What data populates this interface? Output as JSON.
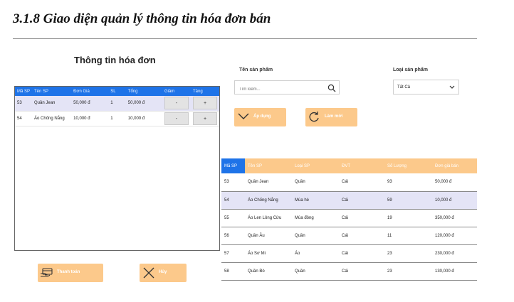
{
  "doc_heading": "3.1.8 Giao diện quản lý thông tin hóa đơn bán",
  "cart": {
    "title": "Thông tin hóa đơn",
    "columns": [
      "Mã SP",
      "Tên SP",
      "Đơn Giá",
      "SL",
      "Tổng",
      "Giảm",
      "Tăng"
    ],
    "rows": [
      {
        "ma": "53",
        "ten": "Quần Jean",
        "gia": "50,000 đ",
        "sl": "1",
        "tong": "50,000 đ",
        "giam": "-",
        "tang": "+"
      },
      {
        "ma": "54",
        "ten": "Áo Chống Nắng",
        "gia": "10,000 đ",
        "sl": "1",
        "tong": "10,000 đ",
        "giam": "-",
        "tang": "+"
      }
    ]
  },
  "filters": {
    "product_name_label": "Tên sản phẩm",
    "search_placeholder": "Tìm kiếm...",
    "category_label": "Loại sản phẩm",
    "category_value": "Tất Cả"
  },
  "buttons": {
    "apply": "Áp dụng",
    "refresh": "Làm mới",
    "pay": "Thanh toán",
    "cancel": "Hủy"
  },
  "products": {
    "columns": [
      "Mã SP",
      "Tên SP",
      "Loại SP",
      "ĐVT",
      "Số Lượng",
      "Đơn giá bán"
    ],
    "rows": [
      {
        "ma": "53",
        "ten": "Quần Jean",
        "loai": "Quần",
        "dvt": "Cái",
        "sl": "93",
        "gia": "50,000 đ"
      },
      {
        "ma": "54",
        "ten": "Áo Chống Nắng",
        "loai": "Mùa hè",
        "dvt": "Cái",
        "sl": "59",
        "gia": "10,000 đ"
      },
      {
        "ma": "55",
        "ten": "Áo Len Lông Cừu",
        "loai": "Mùa đông",
        "dvt": "Cái",
        "sl": "19",
        "gia": "350,000 đ"
      },
      {
        "ma": "56",
        "ten": "Quần Âu",
        "loai": "Quần",
        "dvt": "Cái",
        "sl": "11",
        "gia": "120,000 đ"
      },
      {
        "ma": "57",
        "ten": "Áo Sơ Mi",
        "loai": "Áo",
        "dvt": "Cái",
        "sl": "23",
        "gia": "230,000 đ"
      },
      {
        "ma": "58",
        "ten": "Quần Bò",
        "loai": "Quần",
        "dvt": "Cái",
        "sl": "23",
        "gia": "130,000 đ"
      }
    ]
  },
  "colors": {
    "header_blue": "#1e73e8",
    "accent_orange": "#fcc98b",
    "selected_row": "#e4e4f6"
  },
  "icons": {
    "search": "search-icon",
    "dropdown": "chevron-down-icon",
    "apply": "chevron-down-icon",
    "refresh": "refresh-icon",
    "pay": "payment-icon",
    "cancel": "close-icon"
  }
}
